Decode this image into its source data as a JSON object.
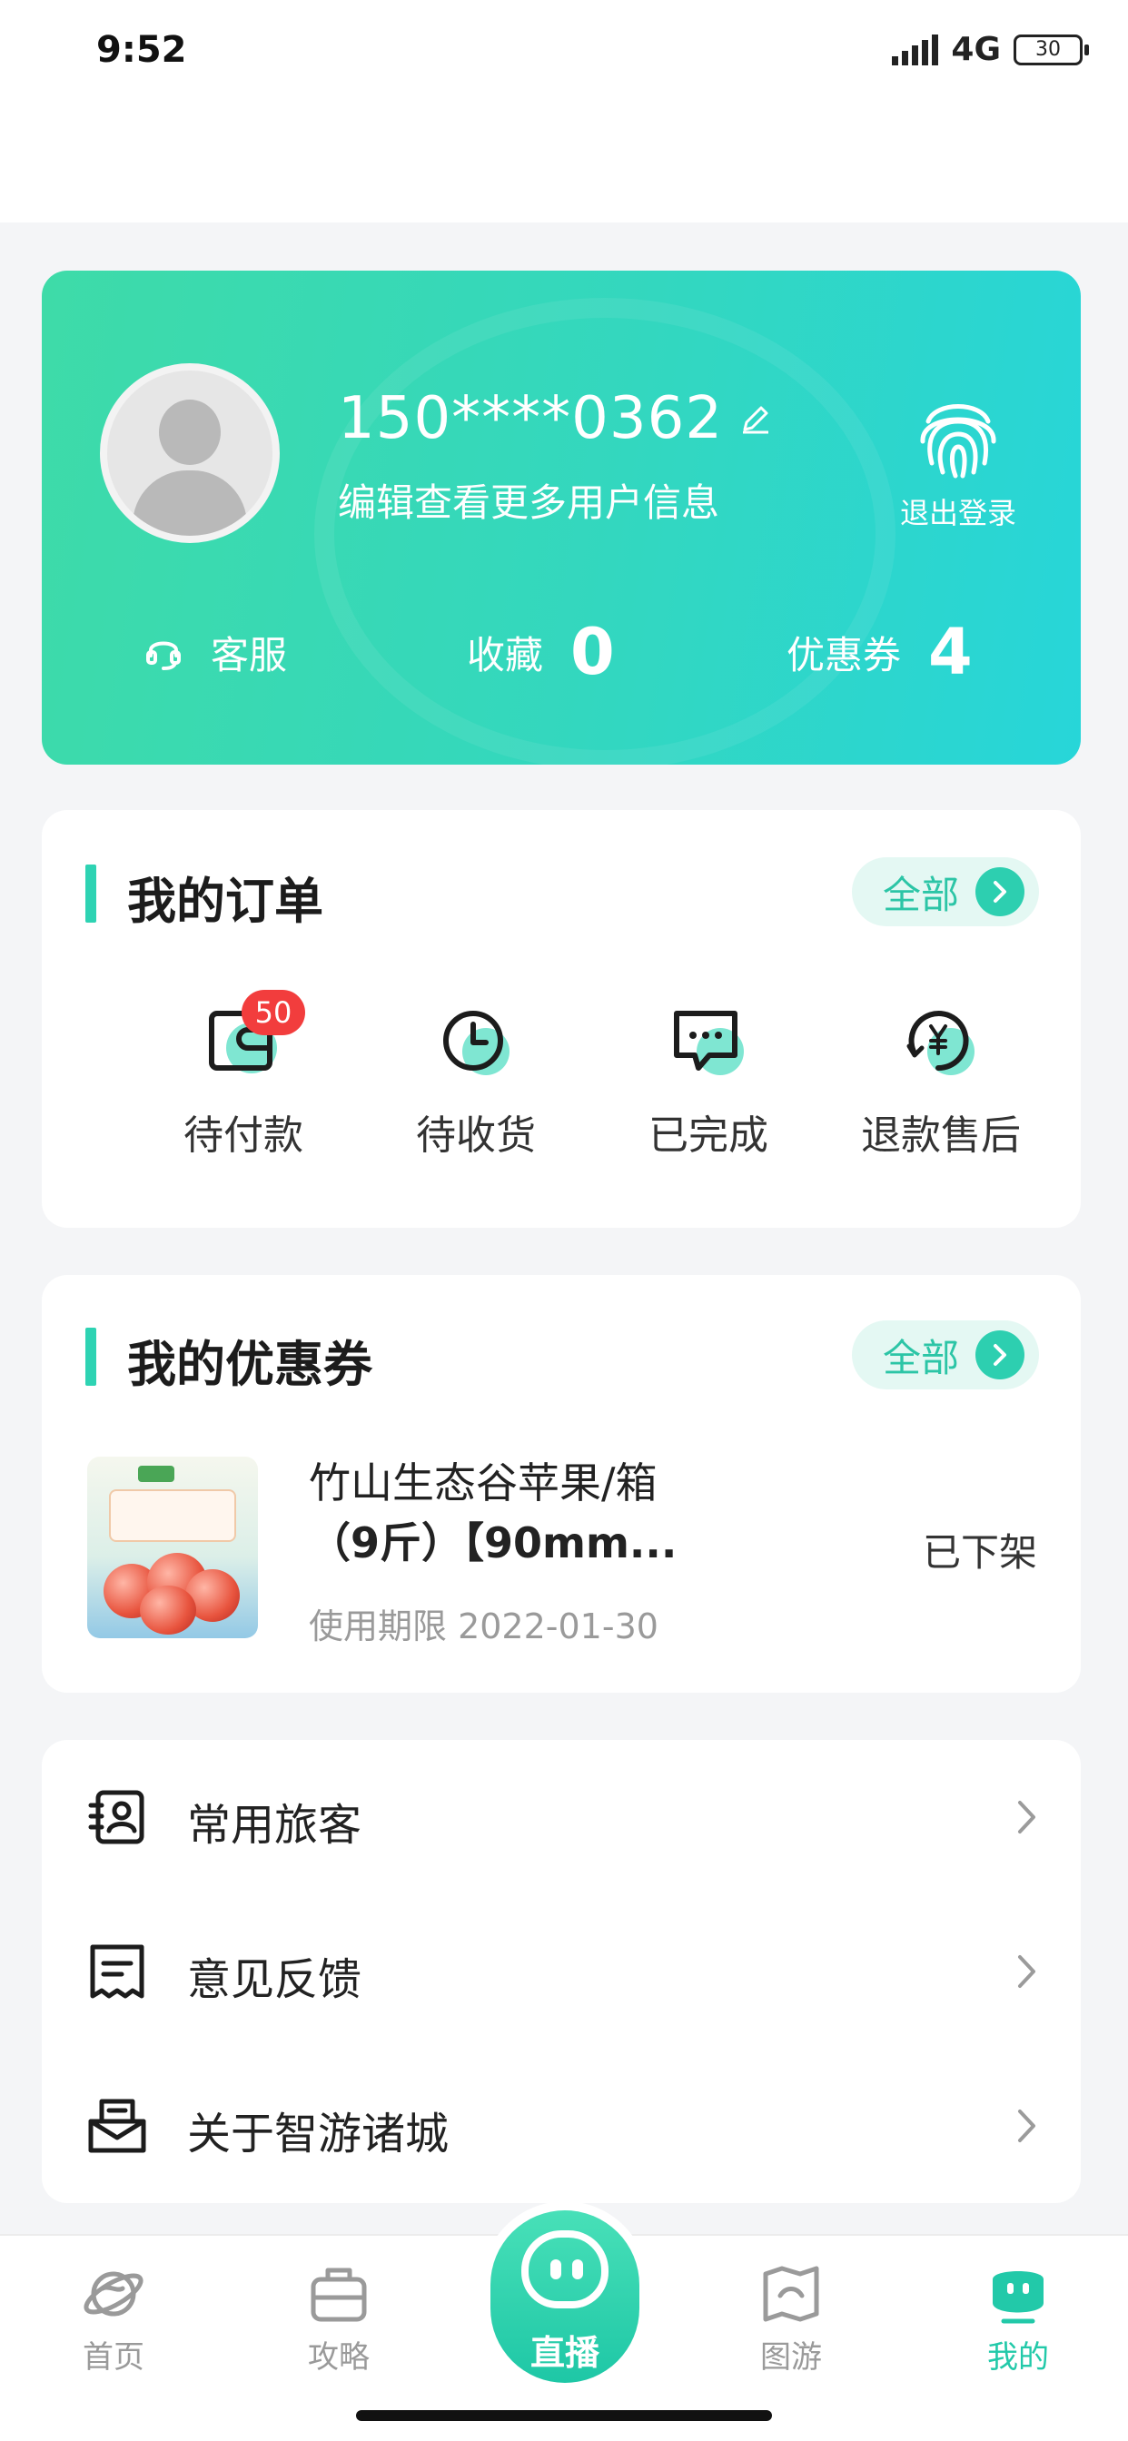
{
  "status_bar": {
    "time": "9:52",
    "network": "4G",
    "battery": "30"
  },
  "profile": {
    "phone": "150****0362",
    "edit_hint": "编辑查看更多用户信息",
    "logout_label": "退出登录",
    "service_label": "客服",
    "favorites_label": "收藏",
    "favorites_count": "0",
    "coupons_label": "优惠券",
    "coupons_count": "4"
  },
  "orders": {
    "title": "我的订单",
    "all_label": "全部",
    "items": [
      {
        "label": "待付款",
        "icon": "wallet-icon",
        "badge": "50"
      },
      {
        "label": "待收货",
        "icon": "clock-icon"
      },
      {
        "label": "已完成",
        "icon": "chat-bubble-icon"
      },
      {
        "label": "退款售后",
        "icon": "yen-refund-icon"
      }
    ]
  },
  "coupons": {
    "title": "我的优惠券",
    "all_label": "全部",
    "item": {
      "name_line1": "竹山生态谷苹果/箱",
      "name_line2": "（9斤）【90mm...",
      "expiry": "使用期限 2022-01-30",
      "status": "已下架"
    }
  },
  "menu": [
    {
      "label": "常用旅客",
      "icon": "traveler-card-icon"
    },
    {
      "label": "意见反馈",
      "icon": "feedback-icon"
    },
    {
      "label": "关于智游诸城",
      "icon": "about-mail-icon"
    }
  ],
  "tabbar": {
    "items": [
      {
        "label": "首页",
        "icon": "planet-icon"
      },
      {
        "label": "攻略",
        "icon": "suitcase-icon"
      },
      {
        "label": "直播",
        "icon": "live-mascot-icon"
      },
      {
        "label": "图游",
        "icon": "map-icon"
      },
      {
        "label": "我的",
        "icon": "mascot-face-icon",
        "active": true
      }
    ]
  },
  "colors": {
    "accent": "#2ed3b3",
    "badge": "#f23d3d",
    "card_gradient_start": "#3edba8",
    "card_gradient_end": "#27d6d9"
  }
}
